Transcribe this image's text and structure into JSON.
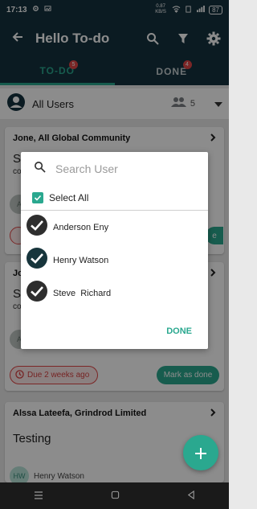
{
  "status_bar": {
    "time": "17:13",
    "net_speed": "0.87 KB/S",
    "battery": "87"
  },
  "app_bar": {
    "title": "Hello To-do"
  },
  "tabs": [
    {
      "label": "TO-DO",
      "badge": "5",
      "active": true
    },
    {
      "label": "DONE",
      "badge": "4",
      "active": false
    }
  ],
  "users_filter": {
    "label": "All Users",
    "count": "5"
  },
  "cards": [
    {
      "header": "Jone, All Global Community",
      "title_partial": "So",
      "sub_partial": "co",
      "avatar_initials": "A",
      "done_partial": "e"
    },
    {
      "header_partial": "Jo",
      "title_partial": "So",
      "sub_partial": "co",
      "avatar_initials": "A",
      "due": "Due 2 weeks ago",
      "mark_done": "Mark as done"
    },
    {
      "header": "Alssa Lateefa, Grindrod Limited",
      "title": "Testing",
      "avatar_initials": "HW",
      "assignee": "Henry Watson"
    }
  ],
  "dialog": {
    "search_placeholder": "Search User",
    "select_all_label": "Select All",
    "users": [
      "Anderson Eny",
      "Henry Watson",
      "Steve  Richard"
    ],
    "done_label": "DONE"
  },
  "colors": {
    "primary": "#15323f",
    "accent": "#2aa88f",
    "danger": "#e04545"
  }
}
